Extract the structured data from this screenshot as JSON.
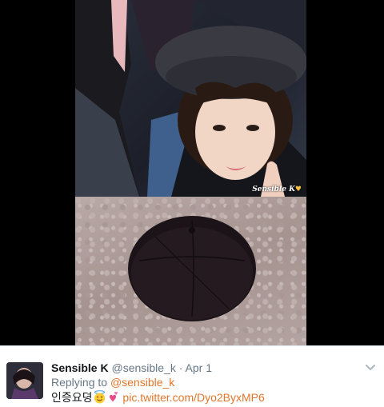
{
  "media": {
    "watermark": "Sensible K"
  },
  "tweet": {
    "display_name": "Sensible K",
    "handle": "@sensible_k",
    "separator": "·",
    "date": "Apr 1",
    "replying_to_label": "Replying to",
    "replying_to_handle": "@sensible_k",
    "text": "인증요뎡",
    "emojis": [
      "smiling-face-with-halo-icon",
      "two-hearts-icon"
    ],
    "link": "pic.twitter.com/Dyo2ByxMP6"
  },
  "colors": {
    "link_accent": "#e0762b",
    "secondary_text": "#657786",
    "primary_text": "#14171a",
    "media_background": "#000000",
    "watermark_heart": "#f5c242"
  }
}
